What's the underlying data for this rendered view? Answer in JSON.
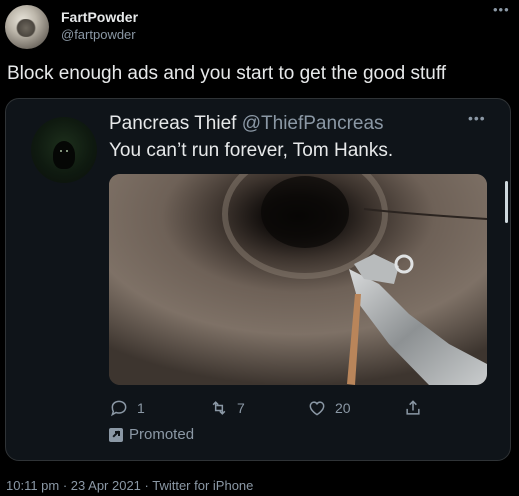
{
  "tweet": {
    "author_name": "FartPowder",
    "author_handle": "@fartpowder",
    "text": "Block enough ads and you start to get the good stuff",
    "more_icon": "more-horizontal-icon",
    "timestamp": "10:11 pm · 23 Apr 2021 · Twitter for iPhone"
  },
  "quoted": {
    "author_name": "Pancreas Thief",
    "author_handle": "@ThiefPancreas",
    "text": "You can’t run forever, Tom Hanks.",
    "more_icon": "more-horizontal-icon",
    "actions": {
      "replies": "1",
      "retweets": "7",
      "likes": "20",
      "reply_icon": "reply-icon",
      "retweet_icon": "retweet-icon",
      "like_icon": "heart-icon",
      "share_icon": "share-icon"
    },
    "promoted_label": "Promoted",
    "promoted_icon": "promoted-arrow-icon"
  },
  "colors": {
    "background": "#000000",
    "card_background": "#0f1419",
    "border": "#2f3336",
    "text_primary": "#e7e9ea",
    "text_secondary": "#8b98a5"
  }
}
